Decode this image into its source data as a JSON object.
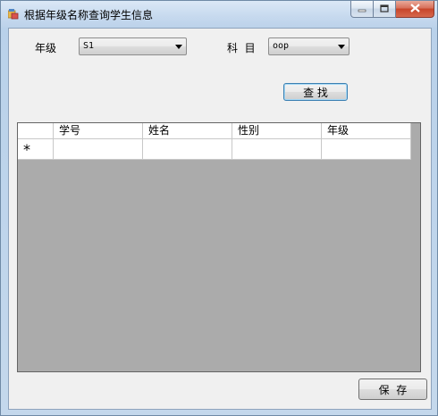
{
  "window": {
    "title": "根据年级名称查询学生信息",
    "icons": {
      "app": "app-window-icon",
      "minimize": "minimize-icon",
      "maximize": "maximize-icon",
      "close": "close-icon"
    }
  },
  "filters": {
    "grade_label": "年级",
    "grade_value": "S1",
    "subject_label": "科  目",
    "subject_value": "oop",
    "search_label": "查 找"
  },
  "grid": {
    "columns": [
      "学号",
      "姓名",
      "性别",
      "年级"
    ],
    "new_row_marker": "*"
  },
  "footer": {
    "save_label": "保  存"
  },
  "colors": {
    "client_bg": "#f0f0f0",
    "grid_bg": "#ababab",
    "close_button": "#c7452a",
    "title_bar": "#c6d9ee"
  }
}
